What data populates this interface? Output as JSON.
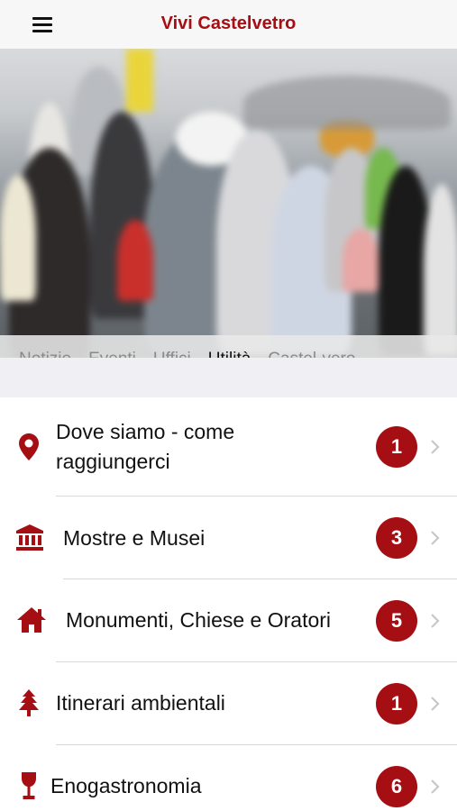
{
  "nav": {
    "title": "Vivi Castelvetro",
    "menu_icon": "hamburger-menu-icon"
  },
  "hero": {
    "image_icon": "crowd-photo"
  },
  "tabs": [
    {
      "label": "Notizie"
    },
    {
      "label": "Eventi"
    },
    {
      "label": "Uffici"
    },
    {
      "label": "Utilità",
      "active": true
    },
    {
      "label": "Castel-vero"
    }
  ],
  "list": {
    "items": [
      {
        "label": "Dove siamo - come raggiungerci",
        "count": "1",
        "icon": "map-pin-icon"
      },
      {
        "label": "Mostre e Musei",
        "count": "3",
        "icon": "museum-icon"
      },
      {
        "label": "Monumenti, Chiese e Oratori",
        "count": "5",
        "icon": "home-icon"
      },
      {
        "label": "Itinerari ambientali",
        "count": "1",
        "icon": "tree-icon"
      },
      {
        "label": "Enogastronomia",
        "count": "6",
        "icon": "wine-glass-icon"
      }
    ]
  },
  "colors": {
    "accent": "#a50e12",
    "navbar_bg": "#f7f7f7",
    "separator_bg": "#efeff4"
  }
}
